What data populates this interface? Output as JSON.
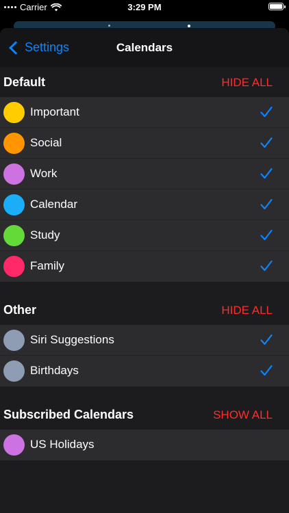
{
  "status_bar": {
    "carrier": "Carrier",
    "time": "3:29 PM"
  },
  "nav": {
    "back_label": "Settings",
    "title": "Calendars"
  },
  "sections": [
    {
      "title": "Default",
      "action": "HIDE ALL",
      "items": [
        {
          "label": "Important",
          "color": "#ffcc00",
          "checked": true
        },
        {
          "label": "Social",
          "color": "#ff9500",
          "checked": true
        },
        {
          "label": "Work",
          "color": "#cc73e1",
          "checked": true
        },
        {
          "label": "Calendar",
          "color": "#1badf8",
          "checked": true
        },
        {
          "label": "Study",
          "color": "#63da38",
          "checked": true
        },
        {
          "label": "Family",
          "color": "#ff2968",
          "checked": true
        }
      ]
    },
    {
      "title": "Other",
      "action": "HIDE ALL",
      "items": [
        {
          "label": "Siri Suggestions",
          "color": "#8e9db3",
          "checked": true
        },
        {
          "label": "Birthdays",
          "color": "#8e9db3",
          "checked": true
        }
      ]
    },
    {
      "title": "Subscribed Calendars",
      "action": "SHOW ALL",
      "items": [
        {
          "label": "US Holidays",
          "color": "#cc73e1",
          "checked": false
        }
      ]
    }
  ],
  "colors": {
    "accent": "#0a84ff",
    "destructive": "#ff2d2d"
  }
}
